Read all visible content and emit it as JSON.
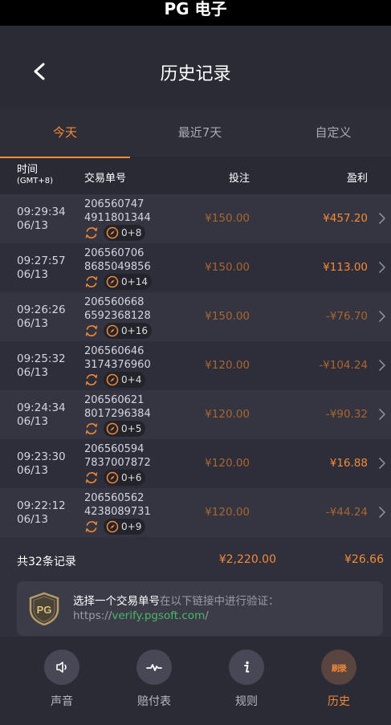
{
  "topbar": {
    "title": "PG 电子"
  },
  "header": {
    "title": "历史记录"
  },
  "tabs": [
    {
      "label": "今天",
      "active": true
    },
    {
      "label": "最近7天",
      "active": false
    },
    {
      "label": "自定义",
      "active": false
    }
  ],
  "table": {
    "headers": {
      "time": "时间",
      "timezone": "(GMT+8)",
      "id": "交易单号",
      "bet": "投注",
      "win": "盈利"
    },
    "rows": [
      {
        "time": "09:29:34",
        "date": "06/13",
        "id_1": "206560747",
        "id_2": "4911801344",
        "spins": "0+8",
        "bet": "¥150.00",
        "win": "¥457.20",
        "positive": true
      },
      {
        "time": "09:27:57",
        "date": "06/13",
        "id_1": "206560706",
        "id_2": "8685049856",
        "spins": "0+14",
        "bet": "¥150.00",
        "win": "¥113.00",
        "positive": true
      },
      {
        "time": "09:26:26",
        "date": "06/13",
        "id_1": "206560668",
        "id_2": "6592368128",
        "spins": "0+16",
        "bet": "¥150.00",
        "win": "-¥76.70",
        "positive": false
      },
      {
        "time": "09:25:32",
        "date": "06/13",
        "id_1": "206560646",
        "id_2": "3174376960",
        "spins": "0+4",
        "bet": "¥120.00",
        "win": "-¥104.24",
        "positive": false
      },
      {
        "time": "09:24:34",
        "date": "06/13",
        "id_1": "206560621",
        "id_2": "8017296384",
        "spins": "0+5",
        "bet": "¥120.00",
        "win": "-¥90.32",
        "positive": false
      },
      {
        "time": "09:23:30",
        "date": "06/13",
        "id_1": "206560594",
        "id_2": "7837007872",
        "spins": "0+6",
        "bet": "¥120.00",
        "win": "¥16.88",
        "positive": true
      },
      {
        "time": "09:22:12",
        "date": "06/13",
        "id_1": "206560562",
        "id_2": "4238089731",
        "spins": "0+9",
        "bet": "¥120.00",
        "win": "-¥44.24",
        "positive": false
      }
    ]
  },
  "summary": {
    "label": "共32条记录",
    "total_bet": "¥2,220.00",
    "total_win": "¥26.66"
  },
  "verify": {
    "strong": "选择一个交易单号",
    "rest": "在以下链接中进行验证：",
    "prefix": "https://",
    "link": "verify.pgsoft.com",
    "suffix": "/"
  },
  "nav": [
    {
      "label": "声音",
      "icon": "speaker-icon",
      "active": false
    },
    {
      "label": "赔付表",
      "icon": "pulse-icon",
      "active": false
    },
    {
      "label": "规则",
      "icon": "info-icon",
      "active": false
    },
    {
      "label": "历史",
      "icon": "history-icon",
      "glyph": "刷录",
      "active": true
    }
  ],
  "colors": {
    "accent": "#f48a36",
    "muted_orange": "#a8662e",
    "link_green": "#4ab868",
    "background": "#2e2e3a"
  }
}
